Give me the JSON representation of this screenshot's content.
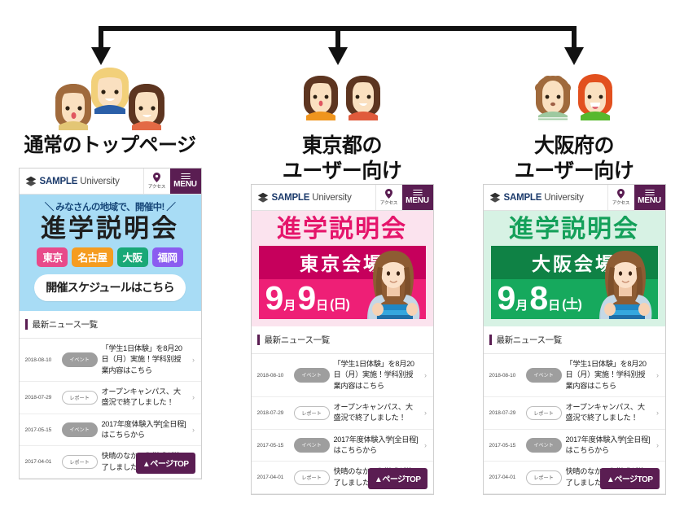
{
  "diagram": {
    "arrow_color": "#111111",
    "branches": 3
  },
  "columns": [
    {
      "id": "default",
      "caption": "通常のトップページ",
      "people_icon": "three-people-group-icon",
      "hero": {
        "variant": "default",
        "background": "#a8dcf5",
        "kicker": "＼ みなさんの地域で、開催中! ／",
        "title": "進学説明会",
        "city_pills": [
          {
            "label": "東京",
            "color": "#e84a8a"
          },
          {
            "label": "名古屋",
            "color": "#f59c20"
          },
          {
            "label": "大阪",
            "color": "#19a877"
          },
          {
            "label": "福岡",
            "color": "#8b5cf0"
          }
        ],
        "cta": "開催スケジュールはこちら"
      }
    },
    {
      "id": "tokyo",
      "caption": "東京都の\nユーザー向け",
      "people_icon": "two-people-pair-icon",
      "hero": {
        "variant": "event",
        "background": "#fbe3ee",
        "title": "進学説明会",
        "title_color": "#e5156b",
        "venue": "東京会場",
        "venue_bar_color": "#c6005c",
        "panel_color": "#ee1f76",
        "date_num_month": "9",
        "date_unit_month": "月",
        "date_num_day": "9",
        "date_unit_day": "日",
        "date_dow": "(日)",
        "photo_alt": "female-student-photo"
      }
    },
    {
      "id": "osaka",
      "caption": "大阪府の\nユーザー向け",
      "people_icon": "two-kids-pair-icon",
      "hero": {
        "variant": "event",
        "background": "#d7f2e4",
        "title": "進学説明会",
        "title_color": "#14a05a",
        "venue": "大阪会場",
        "venue_bar_color": "#0f8245",
        "panel_color": "#16a95d",
        "date_num_month": "9",
        "date_unit_month": "月",
        "date_num_day": "8",
        "date_unit_day": "日",
        "date_dow": "(土)",
        "photo_alt": "female-student-photo"
      }
    }
  ],
  "site": {
    "brand_strong": "SAMPLE",
    "brand_light": " University",
    "access_label": "アクセス",
    "menu_label": "MENU",
    "theme_color": "#5a1d52"
  },
  "news": {
    "heading": "最新ニュース一覧",
    "chevron": "›",
    "pagetop_label": "▲ページTOP",
    "items": [
      {
        "date": "2018-08-10",
        "tag": "イベント",
        "tag_type": "event",
        "title": "「学生1日体験」を8月20日（月）実施！学科別授業内容はこちら"
      },
      {
        "date": "2018-07-29",
        "tag": "レポート",
        "tag_type": "report",
        "title": "オープンキャンパス、大盛況で終了しました！"
      },
      {
        "date": "2017-05-15",
        "tag": "イベント",
        "tag_type": "event",
        "title": "2017年度体験入学[全日程]はこちらから"
      },
      {
        "date": "2017-04-01",
        "tag": "レポート",
        "tag_type": "report",
        "title": "快晴のなか、入学式が終了しました。"
      }
    ]
  }
}
